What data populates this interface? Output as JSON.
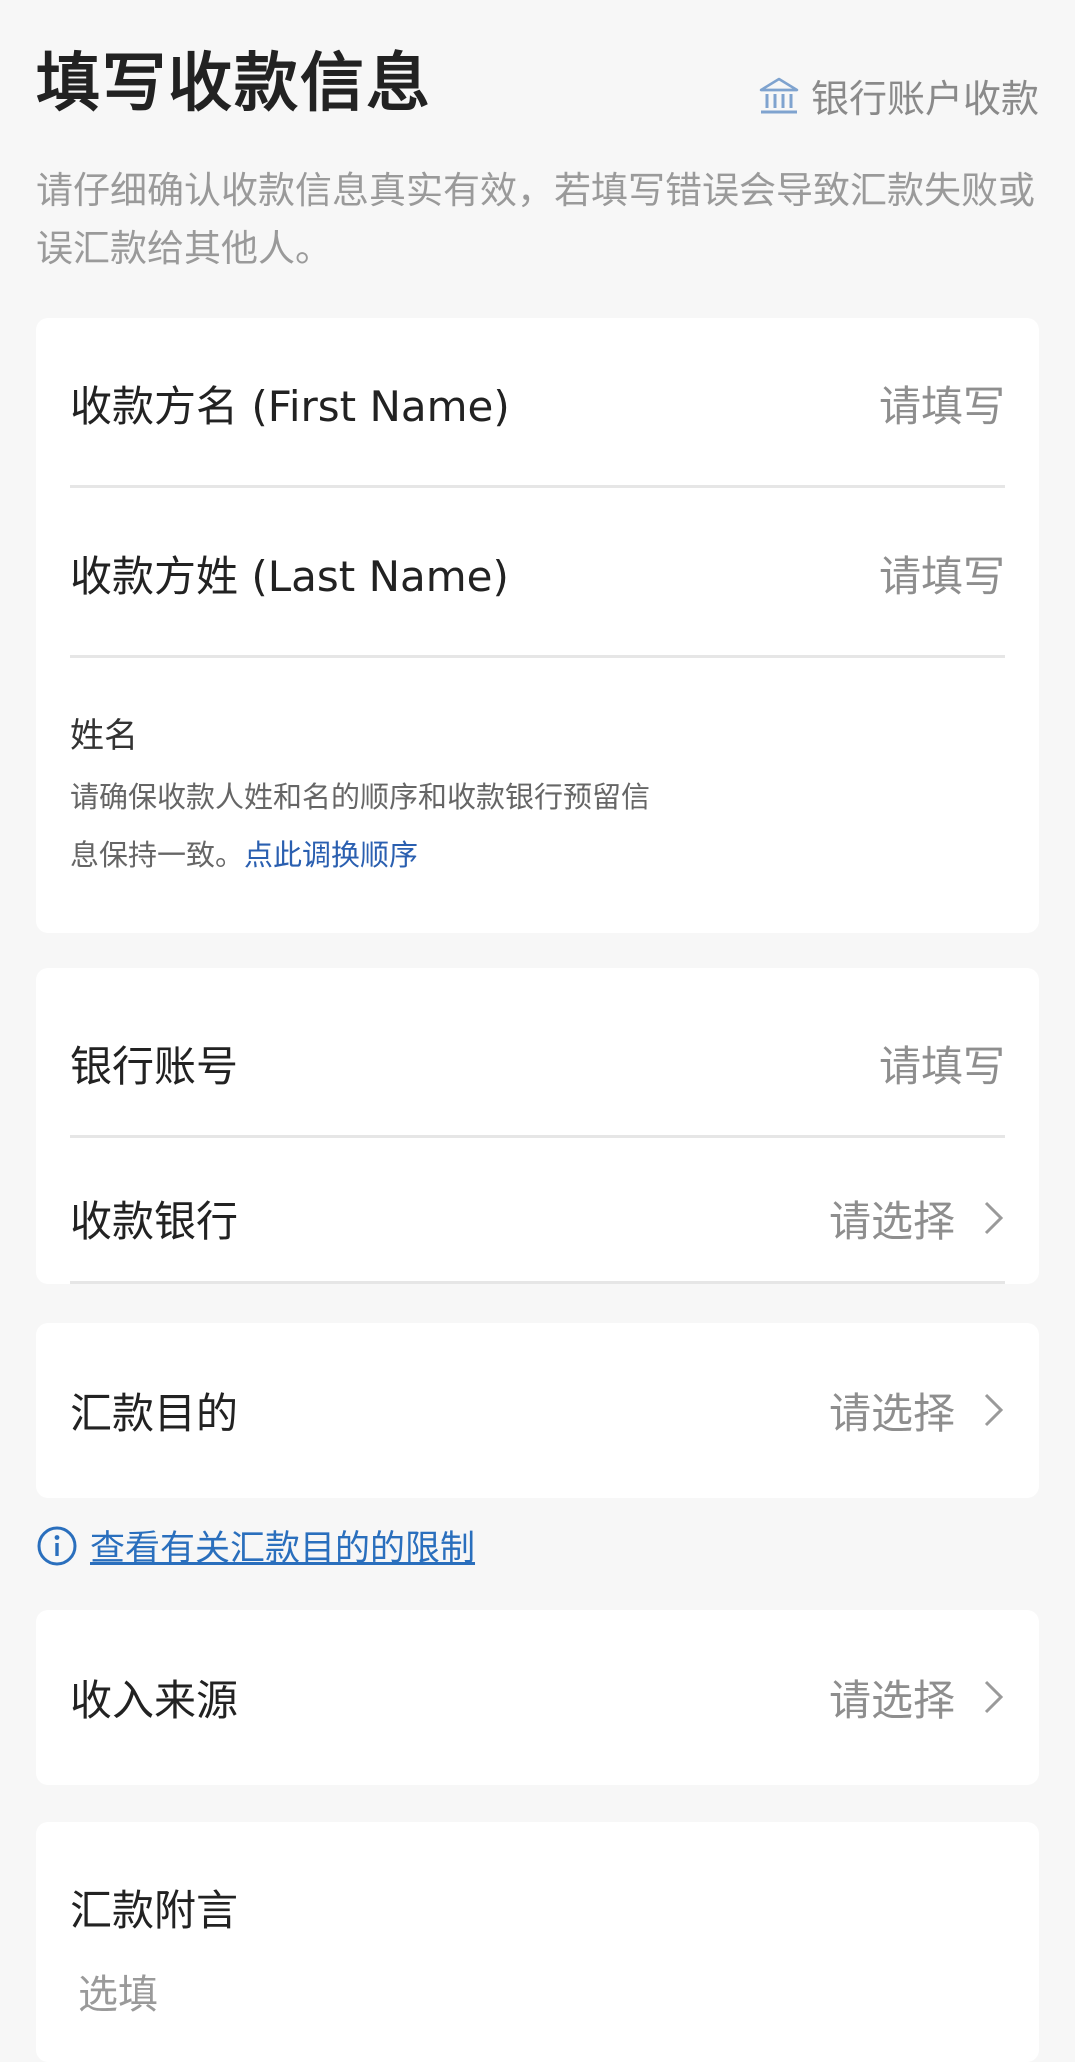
{
  "header": {
    "title": "填写收款信息",
    "switch_label": "银行账户收款",
    "switch_icon": "bank-icon",
    "subtitle": "请仔细确认收款信息真实有效，若填写错误会导致汇款失败或误汇款给其他人。"
  },
  "name_card": {
    "first_name": {
      "label": "收款方名 (First Name)",
      "placeholder": "请填写"
    },
    "last_name": {
      "label": "收款方姓 (Last Name)",
      "placeholder": "请填写"
    },
    "name_title": "姓名",
    "hint_text": "请确保收款人姓和名的顺序和收款银行预留信息保持一致。",
    "hint_link": "点此调换顺序"
  },
  "bank_card": {
    "account": {
      "label": "银行账号",
      "placeholder": "请填写"
    },
    "bank": {
      "label": "收款银行",
      "value": "请选择"
    }
  },
  "purpose_card": {
    "label": "汇款目的",
    "value": "请选择"
  },
  "purpose_info": {
    "icon": "info-icon",
    "link_text": "查看有关汇款目的的限制"
  },
  "source_card": {
    "label": "收入来源",
    "value": "请选择"
  },
  "remark_card": {
    "label": "汇款附言",
    "placeholder": "选填"
  },
  "colors": {
    "accent_link": "#2a6fbd",
    "background": "#f7f7f7",
    "card": "#ffffff"
  }
}
